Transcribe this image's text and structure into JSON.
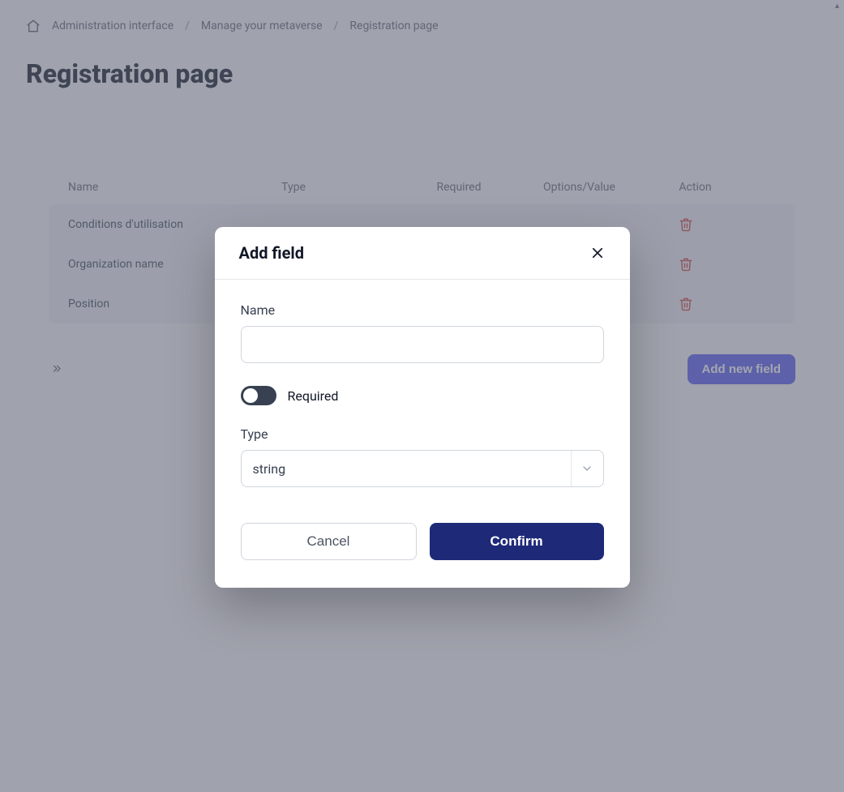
{
  "breadcrumbs": {
    "items": [
      "Administration interface",
      "Manage your metaverse",
      "Registration page"
    ]
  },
  "page": {
    "title": "Registration page"
  },
  "table": {
    "headers": {
      "name": "Name",
      "type": "Type",
      "required": "Required",
      "options": "Options/Value",
      "action": "Action"
    },
    "rows": [
      {
        "name": "Conditions d'utilisation"
      },
      {
        "name": "Organization name"
      },
      {
        "name": "Position"
      }
    ]
  },
  "actions": {
    "add_new_field": "Add new field"
  },
  "modal": {
    "title": "Add field",
    "name_label": "Name",
    "name_value": "",
    "required_label": "Required",
    "required_on": false,
    "type_label": "Type",
    "type_value": "string",
    "cancel": "Cancel",
    "confirm": "Confirm"
  }
}
